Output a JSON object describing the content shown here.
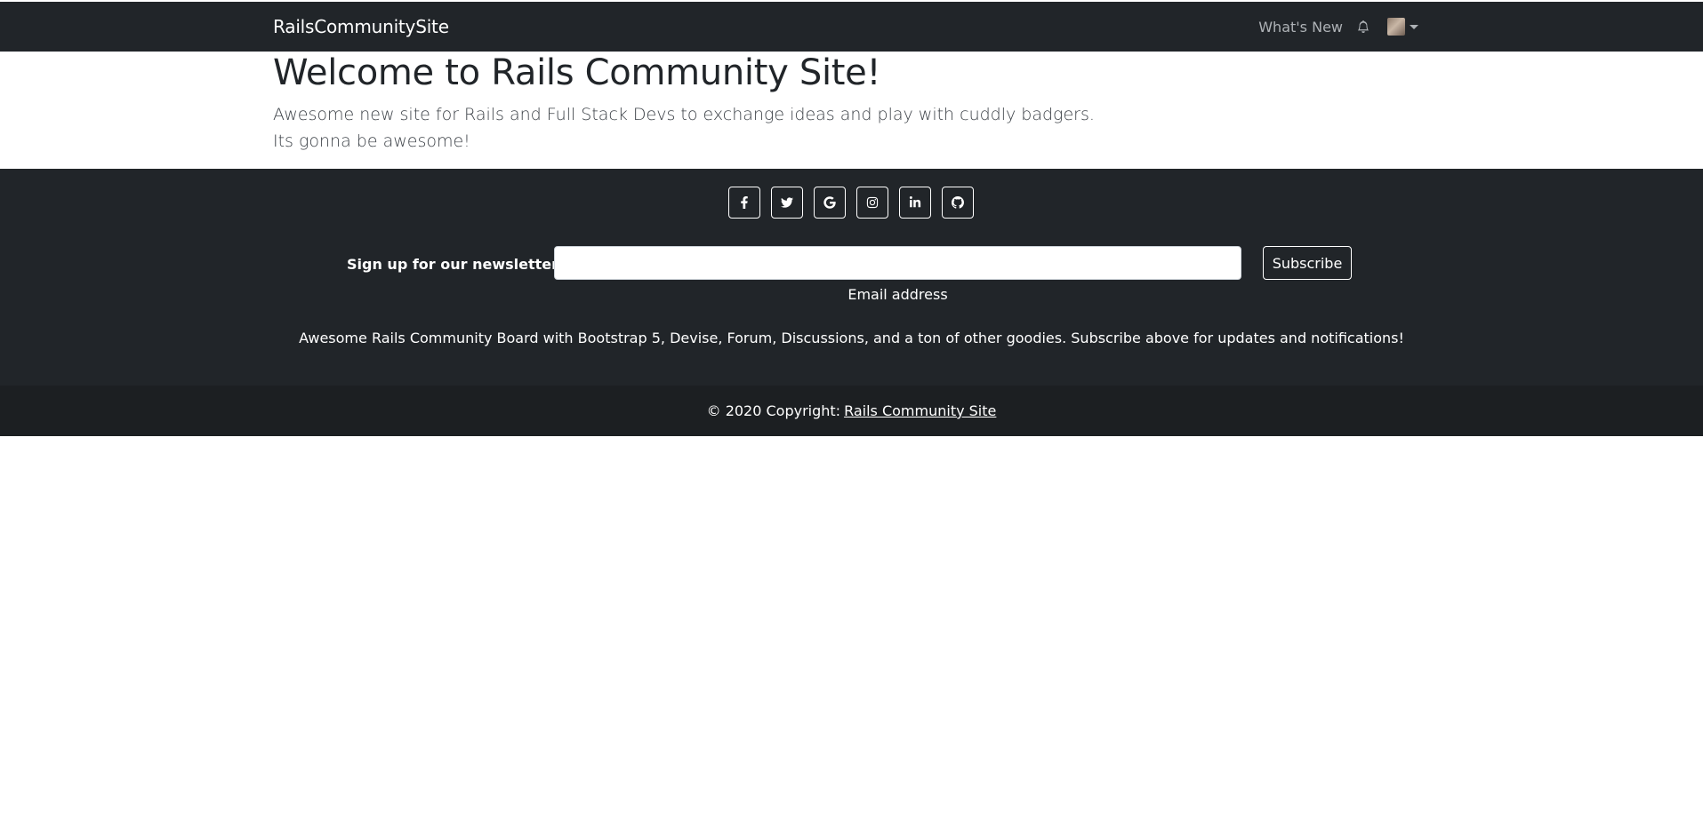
{
  "nav": {
    "brand": "RailsCommunitySite",
    "whats_new": "What's New",
    "bell_icon": "bell-icon",
    "avatar_icon": "user-avatar"
  },
  "hero": {
    "title": "Welcome to Rails Community Site!",
    "line1": "Awesome new site for Rails and Full Stack Devs to exchange ideas and play with cuddly badgers.",
    "line2": "Its gonna be awesome!"
  },
  "footer": {
    "socials": [
      "facebook-icon",
      "twitter-icon",
      "google-icon",
      "instagram-icon",
      "linkedin-icon",
      "github-icon"
    ],
    "newsletter_label": "Sign up for our newsletter",
    "email_value": "",
    "email_help": "Email address",
    "subscribe_label": "Subscribe",
    "blurb": "Awesome Rails Community Board with Bootstrap 5, Devise, Forum, Discussions, and a ton of other goodies. Subscribe above for updates and notifications!",
    "copyright_prefix": "© 2020 Copyright:",
    "copyright_link": "Rails Community Site"
  },
  "colors": {
    "dark": "#212529",
    "darker": "#1c1f22",
    "white": "#ffffff"
  }
}
